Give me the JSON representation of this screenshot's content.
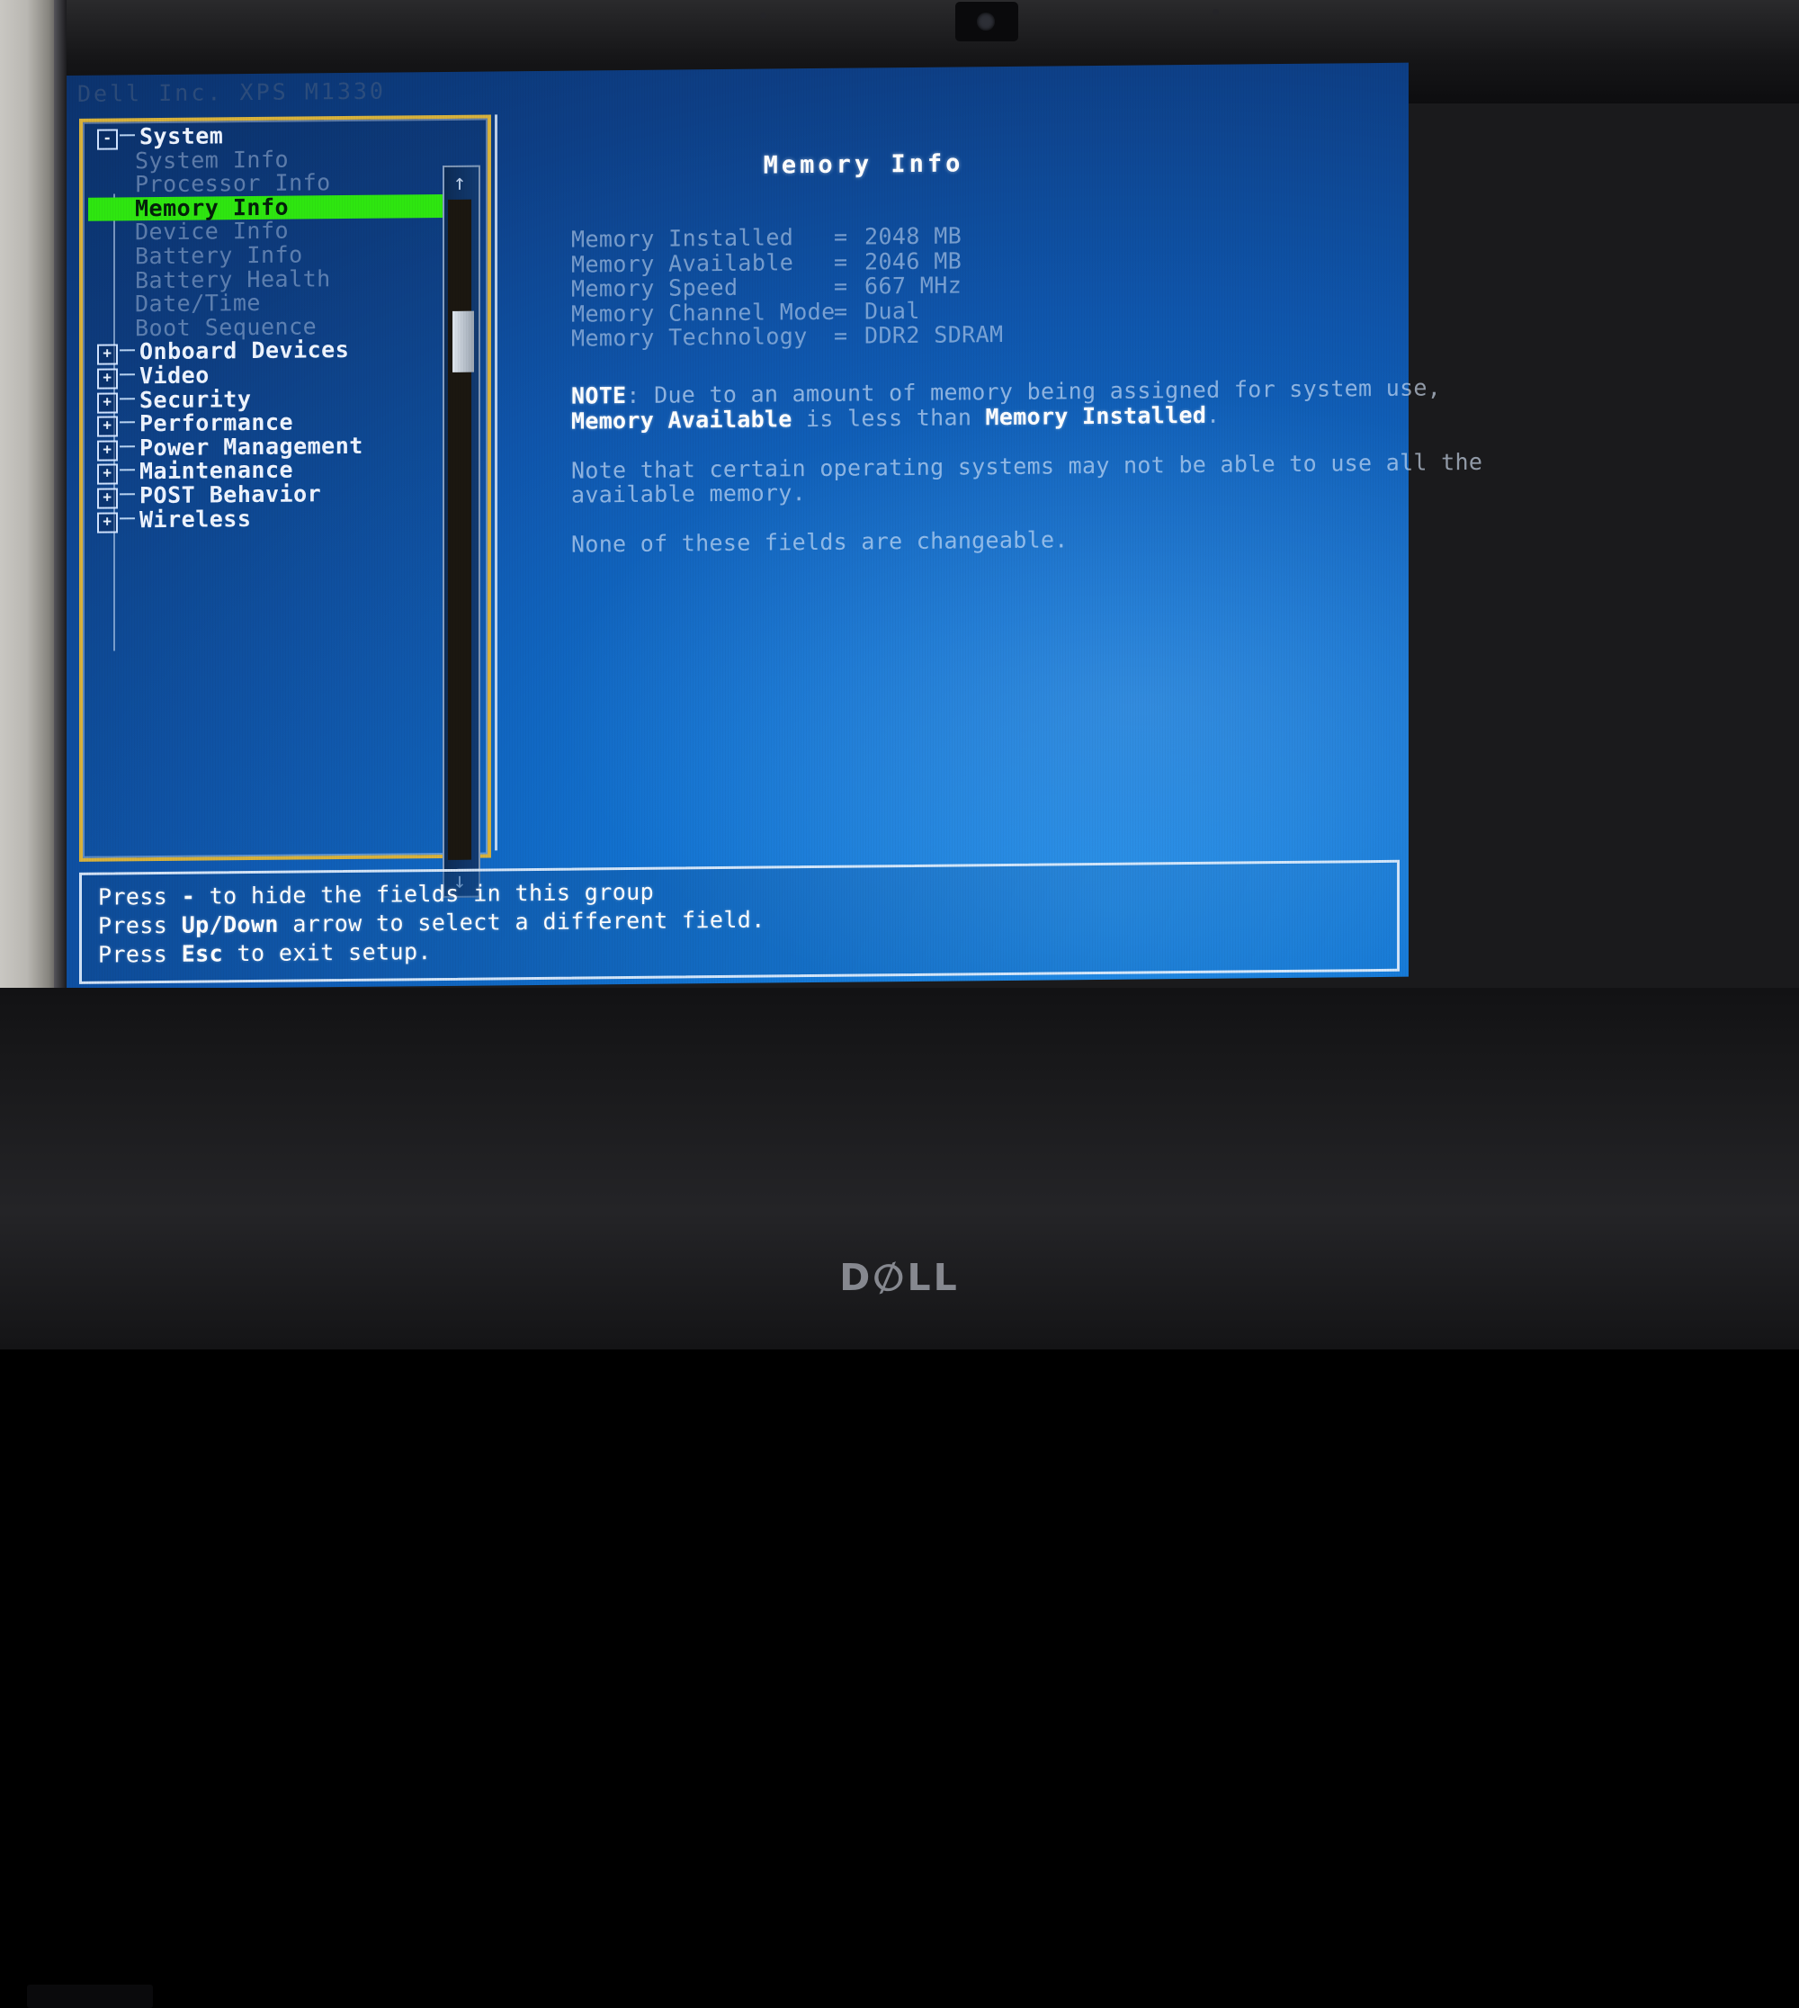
{
  "device": {
    "brand_logo": "DELL",
    "window_title": "Dell Inc. XPS M1330"
  },
  "screen": {
    "header_title": "Dell Inc.  XPS M1330"
  },
  "tree": {
    "name": "setup-navigation-tree",
    "items": [
      {
        "label": "System",
        "level": 0,
        "toggle": "-",
        "state": "expanded",
        "selected": false
      },
      {
        "label": "System Info",
        "level": 1,
        "toggle": "",
        "state": "dim",
        "selected": false
      },
      {
        "label": "Processor Info",
        "level": 1,
        "toggle": "",
        "state": "dim",
        "selected": false
      },
      {
        "label": "Memory Info",
        "level": 1,
        "toggle": "",
        "state": "selected",
        "selected": true
      },
      {
        "label": "Device Info",
        "level": 1,
        "toggle": "",
        "state": "dim",
        "selected": false
      },
      {
        "label": "Battery Info",
        "level": 1,
        "toggle": "",
        "state": "dim",
        "selected": false
      },
      {
        "label": "Battery Health",
        "level": 1,
        "toggle": "",
        "state": "dim",
        "selected": false
      },
      {
        "label": "Date/Time",
        "level": 1,
        "toggle": "",
        "state": "dim",
        "selected": false
      },
      {
        "label": "Boot Sequence",
        "level": 1,
        "toggle": "",
        "state": "dim",
        "selected": false
      },
      {
        "label": "Onboard Devices",
        "level": 0,
        "toggle": "+",
        "state": "collapsed",
        "selected": false
      },
      {
        "label": "Video",
        "level": 0,
        "toggle": "+",
        "state": "collapsed",
        "selected": false
      },
      {
        "label": "Security",
        "level": 0,
        "toggle": "+",
        "state": "collapsed",
        "selected": false
      },
      {
        "label": "Performance",
        "level": 0,
        "toggle": "+",
        "state": "collapsed",
        "selected": false
      },
      {
        "label": "Power Management",
        "level": 0,
        "toggle": "+",
        "state": "collapsed",
        "selected": false
      },
      {
        "label": "Maintenance",
        "level": 0,
        "toggle": "+",
        "state": "collapsed",
        "selected": false
      },
      {
        "label": "POST Behavior",
        "level": 0,
        "toggle": "+",
        "state": "collapsed",
        "selected": false
      },
      {
        "label": "Wireless",
        "level": 0,
        "toggle": "+",
        "state": "collapsed",
        "selected": false
      }
    ]
  },
  "scrollbar": {
    "up_icon": "arrow-up-icon",
    "down_icon": "arrow-down-icon",
    "up_glyph": "↑",
    "down_glyph": "↓"
  },
  "content": {
    "title": "Memory Info",
    "fields": [
      {
        "label": "Memory Installed",
        "eq": "=",
        "value": "2048 MB"
      },
      {
        "label": "Memory Available",
        "eq": "=",
        "value": "2046 MB"
      },
      {
        "label": "Memory Speed",
        "eq": "=",
        "value": "667 MHz"
      },
      {
        "label": "Memory Channel Mode",
        "eq": "=",
        "value": "Dual"
      },
      {
        "label": "Memory Technology",
        "eq": "=",
        "value": "DDR2 SDRAM"
      }
    ],
    "notes": {
      "note_bold": "NOTE",
      "note_p1_a": ": Due to an amount of memory being assigned for system use,",
      "note_p1_bold1": "Memory Available",
      "note_p1_b": " is less than ",
      "note_p1_bold2": "Memory Installed",
      "note_p1_c": ".",
      "note_p2": "Note that certain operating systems may not be able to use all the available memory.",
      "note_p3": "None of these fields are changeable."
    }
  },
  "help": {
    "lines": [
      {
        "pre": "Press ",
        "key": "-",
        "post": " to hide the fields in this group"
      },
      {
        "pre": "Press ",
        "key": "Up/Down",
        "post": " arrow to select a different field."
      },
      {
        "pre": "Press ",
        "key": "Esc",
        "post": " to exit setup."
      }
    ]
  },
  "colors": {
    "selection_green": "#2ee610",
    "pane_border_gold": "#d8b23c",
    "screen_blue": "#1272d0",
    "text_white": "#ffffff"
  }
}
